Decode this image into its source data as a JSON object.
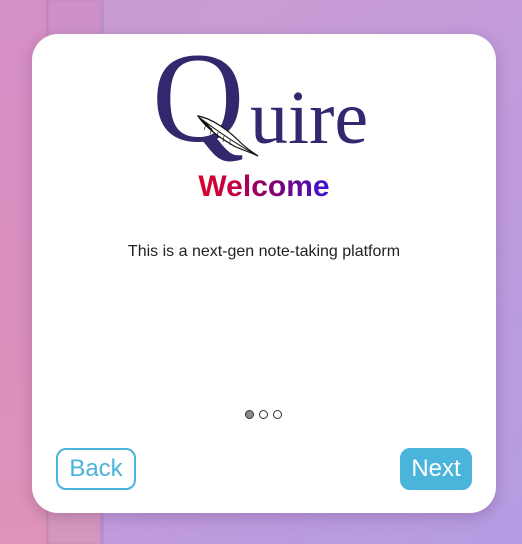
{
  "logo": {
    "first_letter": "Q",
    "rest": "uire",
    "quill_icon": "feather-quill-icon"
  },
  "welcome": {
    "title": "Welcome"
  },
  "description": "This is a next-gen note-taking platform",
  "pagination": {
    "total": 3,
    "current": 1
  },
  "buttons": {
    "back_label": "Back",
    "next_label": "Next"
  },
  "colors": {
    "accent": "#4ab4db",
    "logo": "#33286e",
    "title_gradient_start": "#d8022c",
    "title_gradient_end": "#3a18d4"
  }
}
